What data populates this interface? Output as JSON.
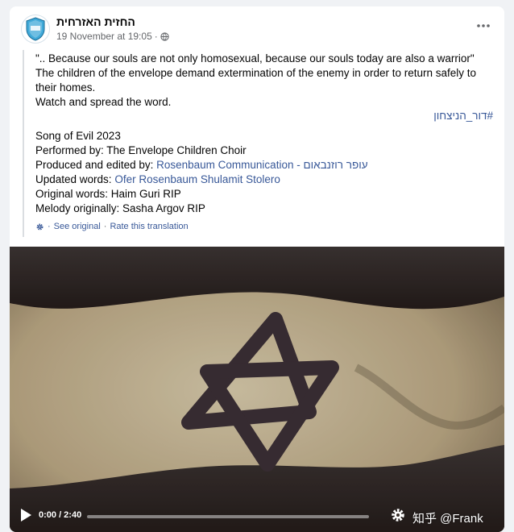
{
  "post": {
    "page_name": "החזית האזרחית",
    "timestamp": "19 November at 19:05",
    "privacy_icon": "globe-icon",
    "more_icon": "more-icon"
  },
  "translation": {
    "line1": "\".. Because our souls are not only homosexual, because our souls today are also a warrior\"",
    "line2": "The children of the envelope demand extermination of the enemy in order to return safely to",
    "line3": "their homes.",
    "line4": "Watch and spread the word.",
    "hashtag": "#דור_הניצחון",
    "song_title": "Song of Evil 2023",
    "performed_by": "Performed by: The Envelope Children Choir",
    "produced_prefix": "Produced and edited by:",
    "produced_link": "Rosenbaum Communication - עופר רוזנבאום",
    "updated_prefix": "Updated words:",
    "updated_link": "Ofer Rosenbaum Shulamit Stolero",
    "original_words": "Original words: Haim Guri RIP",
    "melody": "Melody originally: Sasha Argov RIP",
    "see_original": "See original",
    "separator": "·",
    "rate_translation": "Rate this translation"
  },
  "video": {
    "time": "0:00 / 2:40",
    "progress_fraction": 0,
    "play_icon": "play-icon",
    "settings_icon": "settings-icon",
    "watermark": "知乎 @Frank"
  },
  "colors": {
    "link": "#385898",
    "secondary_text": "#65676b",
    "background": "#f0f2f5"
  }
}
